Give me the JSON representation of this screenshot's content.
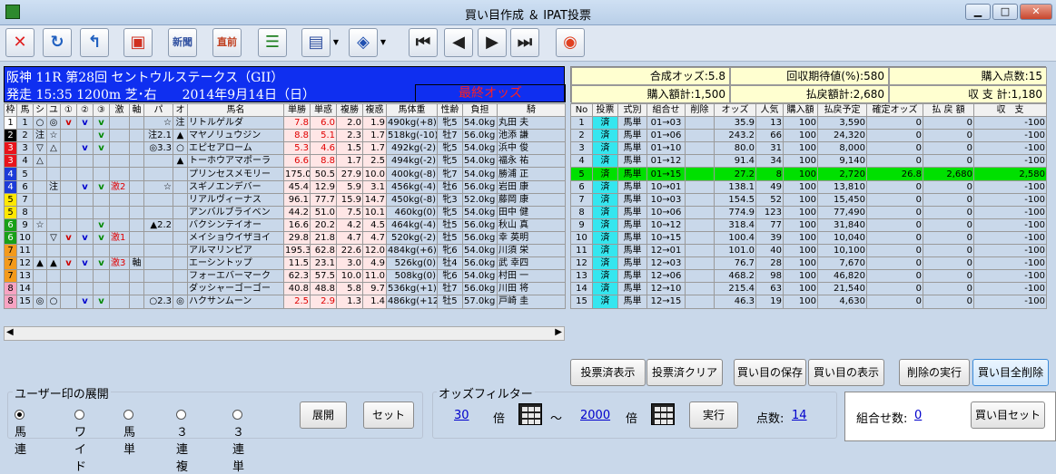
{
  "window": {
    "title": "買い目作成 ＆ IPAT投票"
  },
  "toolbar": {
    "buttons": [
      {
        "label": "✕",
        "name": "close-icon"
      },
      {
        "label": "↻",
        "name": "refresh-icon"
      },
      {
        "label": "↰",
        "name": "return-icon"
      },
      {
        "label": "▣",
        "name": "screen-icon"
      },
      {
        "label": "新聞",
        "name": "newspaper-icon"
      },
      {
        "label": "直前",
        "name": "latest-icon"
      },
      {
        "label": "☰",
        "name": "list-icon"
      },
      {
        "label": "▤",
        "name": "document-check-icon"
      },
      {
        "label": "◈",
        "name": "ipat-icon"
      },
      {
        "label": "⏮",
        "name": "first-icon"
      },
      {
        "label": "◀",
        "name": "prev-icon"
      },
      {
        "label": "▶",
        "name": "next-icon"
      },
      {
        "label": "⏭",
        "name": "last-icon"
      },
      {
        "label": "◉",
        "name": "exit-icon"
      }
    ]
  },
  "race": {
    "line1": "阪神 11R 第28回 セントウルステークス（GII）",
    "line2": "発走 15:35 1200m 芝･右　　2014年9月14日（日）",
    "status": "最終オッズ"
  },
  "summary": {
    "synth": "合成オッズ:5.8",
    "expect": "回収期待値(%):580",
    "points": "購入点数:15",
    "total": "購入額計:1,500",
    "refund": "払戻額計:2,680",
    "balance": "収 支 計:1,180"
  },
  "left_headers": [
    "枠",
    "馬",
    "シ",
    "ユ",
    "①",
    "②",
    "③",
    "激",
    "軸",
    "パ",
    "オ",
    "馬名",
    "単勝",
    "単惑",
    "複勝",
    "複惑",
    "馬体重",
    "性齢",
    "負担",
    "騎"
  ],
  "horses": [
    {
      "waku": "1",
      "no": "1",
      "s": "○",
      "u": "◎",
      "m1": "v",
      "m2": "v",
      "m3": "v",
      "geki": "",
      "jiku": "",
      "pa": "☆",
      "o": "注",
      "name": "リトルゲルダ",
      "win": "7.8",
      "wodd": "6.0",
      "place": "2.0",
      "podd": "1.9",
      "weight": "490kg(+8)",
      "sex": "牝5",
      "load": "54.0kg",
      "jockey": "丸田 夫"
    },
    {
      "waku": "2",
      "no": "2",
      "s": "注",
      "u": "☆",
      "m1": "",
      "m2": "",
      "m3": "v",
      "geki": "",
      "jiku": "",
      "pa": "注2.1",
      "o": "▲",
      "name": "マヤノリュウジン",
      "win": "8.8",
      "wodd": "5.1",
      "place": "2.3",
      "podd": "1.7",
      "weight": "518kg(-10)",
      "sex": "牡7",
      "load": "56.0kg",
      "jockey": "池添 謙"
    },
    {
      "waku": "3",
      "no": "3",
      "s": "▽",
      "u": "△",
      "m1": "",
      "m2": "v",
      "m3": "v",
      "geki": "",
      "jiku": "",
      "pa": "◎3.3",
      "o": "○",
      "name": "エピセアローム",
      "win": "5.3",
      "wodd": "4.6",
      "place": "1.5",
      "podd": "1.7",
      "weight": "492kg(-2)",
      "sex": "牝5",
      "load": "54.0kg",
      "jockey": "浜中 俊"
    },
    {
      "waku": "3",
      "no": "4",
      "s": "△",
      "u": "",
      "m1": "",
      "m2": "",
      "m3": "",
      "geki": "",
      "jiku": "",
      "pa": "",
      "o": "▲",
      "name": "トーホウアマポーラ",
      "win": "6.6",
      "wodd": "8.8",
      "place": "1.7",
      "podd": "2.5",
      "weight": "494kg(-2)",
      "sex": "牝5",
      "load": "54.0kg",
      "jockey": "福永 祐"
    },
    {
      "waku": "4",
      "no": "5",
      "s": "",
      "u": "",
      "m1": "",
      "m2": "",
      "m3": "",
      "geki": "",
      "jiku": "",
      "pa": "",
      "o": "",
      "name": "プリンセスメモリー",
      "win": "175.0",
      "wodd": "50.5",
      "place": "27.9",
      "podd": "10.0",
      "weight": "400kg(-8)",
      "sex": "牝7",
      "load": "54.0kg",
      "jockey": "勝浦 正"
    },
    {
      "waku": "4",
      "no": "6",
      "s": "",
      "u": "注",
      "m1": "",
      "m2": "v",
      "m3": "v",
      "geki": "激2",
      "jiku": "",
      "pa": "☆",
      "o": "",
      "name": "スギノエンデバー",
      "win": "45.4",
      "wodd": "12.9",
      "place": "5.9",
      "podd": "3.1",
      "weight": "456kg(-4)",
      "sex": "牡6",
      "load": "56.0kg",
      "jockey": "岩田 康"
    },
    {
      "waku": "5",
      "no": "7",
      "s": "",
      "u": "",
      "m1": "",
      "m2": "",
      "m3": "",
      "geki": "",
      "jiku": "",
      "pa": "",
      "o": "",
      "name": "リアルヴィーナス",
      "win": "96.1",
      "wodd": "77.7",
      "place": "15.9",
      "podd": "14.7",
      "weight": "450kg(-8)",
      "sex": "牝3",
      "load": "52.0kg",
      "jockey": "藤岡 康"
    },
    {
      "waku": "5",
      "no": "8",
      "s": "",
      "u": "",
      "m1": "",
      "m2": "",
      "m3": "",
      "geki": "",
      "jiku": "",
      "pa": "",
      "o": "",
      "name": "アンバルブライベン",
      "win": "44.2",
      "wodd": "51.0",
      "place": "7.5",
      "podd": "10.1",
      "weight": "460kg(0)",
      "sex": "牝5",
      "load": "54.0kg",
      "jockey": "田中 健"
    },
    {
      "waku": "6",
      "no": "9",
      "s": "☆",
      "u": "",
      "m1": "",
      "m2": "",
      "m3": "v",
      "geki": "",
      "jiku": "",
      "pa": "▲2.2",
      "o": "",
      "name": "バクシンテイオー",
      "win": "16.6",
      "wodd": "20.2",
      "place": "4.2",
      "podd": "4.5",
      "weight": "464kg(-4)",
      "sex": "牡5",
      "load": "56.0kg",
      "jockey": "秋山 真"
    },
    {
      "waku": "6",
      "no": "10",
      "s": "",
      "u": "▽",
      "m1": "v",
      "m2": "v",
      "m3": "v",
      "geki": "激1",
      "jiku": "",
      "pa": "",
      "o": "",
      "name": "メイショウイザヨイ",
      "win": "29.8",
      "wodd": "21.8",
      "place": "4.7",
      "podd": "4.7",
      "weight": "520kg(-2)",
      "sex": "牡5",
      "load": "56.0kg",
      "jockey": "幸 英明"
    },
    {
      "waku": "7",
      "no": "11",
      "s": "",
      "u": "",
      "m1": "",
      "m2": "",
      "m3": "",
      "geki": "",
      "jiku": "",
      "pa": "",
      "o": "",
      "name": "アルマリンピア",
      "win": "195.3",
      "wodd": "62.8",
      "place": "22.6",
      "podd": "12.0",
      "weight": "484kg(+6)",
      "sex": "牝6",
      "load": "54.0kg",
      "jockey": "川須 栄"
    },
    {
      "waku": "7",
      "no": "12",
      "s": "▲",
      "u": "▲",
      "m1": "v",
      "m2": "v",
      "m3": "v",
      "geki": "激3",
      "jiku": "軸",
      "pa": "",
      "o": "",
      "name": "エーシントップ",
      "win": "11.5",
      "wodd": "23.1",
      "place": "3.0",
      "podd": "4.9",
      "weight": "526kg(0)",
      "sex": "牡4",
      "load": "56.0kg",
      "jockey": "武 幸四"
    },
    {
      "waku": "7",
      "no": "13",
      "s": "",
      "u": "",
      "m1": "",
      "m2": "",
      "m3": "",
      "geki": "",
      "jiku": "",
      "pa": "",
      "o": "",
      "name": "フォーエバーマーク",
      "win": "62.3",
      "wodd": "57.5",
      "place": "10.0",
      "podd": "11.0",
      "weight": "508kg(0)",
      "sex": "牝6",
      "load": "54.0kg",
      "jockey": "村田 一"
    },
    {
      "waku": "8",
      "no": "14",
      "s": "",
      "u": "",
      "m1": "",
      "m2": "",
      "m3": "",
      "geki": "",
      "jiku": "",
      "pa": "",
      "o": "",
      "name": "ダッシャーゴーゴー",
      "win": "40.8",
      "wodd": "48.8",
      "place": "5.8",
      "podd": "9.7",
      "weight": "536kg(+1)",
      "sex": "牡7",
      "load": "56.0kg",
      "jockey": "川田 将"
    },
    {
      "waku": "8",
      "no": "15",
      "s": "◎",
      "u": "○",
      "m1": "",
      "m2": "v",
      "m3": "v",
      "geki": "",
      "jiku": "",
      "pa": "○2.3",
      "o": "◎",
      "name": "ハクサンムーン",
      "win": "2.5",
      "wodd": "2.9",
      "place": "1.3",
      "podd": "1.4",
      "weight": "486kg(+12)",
      "sex": "牡5",
      "load": "57.0kg",
      "jockey": "戸崎 圭"
    }
  ],
  "right_headers": [
    "No",
    "投票",
    "式別",
    "組合せ",
    "削除",
    "オッズ",
    "人気",
    "購入額",
    "払戻予定",
    "確定オッズ",
    "払 戻 額",
    "収　支"
  ],
  "bets": [
    {
      "no": "1",
      "vote": "済",
      "type": "馬単",
      "combo": "01→03",
      "del": "",
      "odds": "35.9",
      "pop": "13",
      "amt": "100",
      "ref": "3,590",
      "fodds": "0",
      "pay": "0",
      "bal": "-100"
    },
    {
      "no": "2",
      "vote": "済",
      "type": "馬単",
      "combo": "01→06",
      "del": "",
      "odds": "243.2",
      "pop": "66",
      "amt": "100",
      "ref": "24,320",
      "fodds": "0",
      "pay": "0",
      "bal": "-100"
    },
    {
      "no": "3",
      "vote": "済",
      "type": "馬単",
      "combo": "01→10",
      "del": "",
      "odds": "80.0",
      "pop": "31",
      "amt": "100",
      "ref": "8,000",
      "fodds": "0",
      "pay": "0",
      "bal": "-100"
    },
    {
      "no": "4",
      "vote": "済",
      "type": "馬単",
      "combo": "01→12",
      "del": "",
      "odds": "91.4",
      "pop": "34",
      "amt": "100",
      "ref": "9,140",
      "fodds": "0",
      "pay": "0",
      "bal": "-100"
    },
    {
      "no": "5",
      "vote": "済",
      "type": "馬単",
      "combo": "01→15",
      "del": "",
      "odds": "27.2",
      "pop": "8",
      "amt": "100",
      "ref": "2,720",
      "fodds": "26.8",
      "pay": "2,680",
      "bal": "2,580",
      "hit": true
    },
    {
      "no": "6",
      "vote": "済",
      "type": "馬単",
      "combo": "10→01",
      "del": "",
      "odds": "138.1",
      "pop": "49",
      "amt": "100",
      "ref": "13,810",
      "fodds": "0",
      "pay": "0",
      "bal": "-100"
    },
    {
      "no": "7",
      "vote": "済",
      "type": "馬単",
      "combo": "10→03",
      "del": "",
      "odds": "154.5",
      "pop": "52",
      "amt": "100",
      "ref": "15,450",
      "fodds": "0",
      "pay": "0",
      "bal": "-100"
    },
    {
      "no": "8",
      "vote": "済",
      "type": "馬単",
      "combo": "10→06",
      "del": "",
      "odds": "774.9",
      "pop": "123",
      "amt": "100",
      "ref": "77,490",
      "fodds": "0",
      "pay": "0",
      "bal": "-100"
    },
    {
      "no": "9",
      "vote": "済",
      "type": "馬単",
      "combo": "10→12",
      "del": "",
      "odds": "318.4",
      "pop": "77",
      "amt": "100",
      "ref": "31,840",
      "fodds": "0",
      "pay": "0",
      "bal": "-100"
    },
    {
      "no": "10",
      "vote": "済",
      "type": "馬単",
      "combo": "10→15",
      "del": "",
      "odds": "100.4",
      "pop": "39",
      "amt": "100",
      "ref": "10,040",
      "fodds": "0",
      "pay": "0",
      "bal": "-100"
    },
    {
      "no": "11",
      "vote": "済",
      "type": "馬単",
      "combo": "12→01",
      "del": "",
      "odds": "101.0",
      "pop": "40",
      "amt": "100",
      "ref": "10,100",
      "fodds": "0",
      "pay": "0",
      "bal": "-100"
    },
    {
      "no": "12",
      "vote": "済",
      "type": "馬単",
      "combo": "12→03",
      "del": "",
      "odds": "76.7",
      "pop": "28",
      "amt": "100",
      "ref": "7,670",
      "fodds": "0",
      "pay": "0",
      "bal": "-100"
    },
    {
      "no": "13",
      "vote": "済",
      "type": "馬単",
      "combo": "12→06",
      "del": "",
      "odds": "468.2",
      "pop": "98",
      "amt": "100",
      "ref": "46,820",
      "fodds": "0",
      "pay": "0",
      "bal": "-100"
    },
    {
      "no": "14",
      "vote": "済",
      "type": "馬単",
      "combo": "12→10",
      "del": "",
      "odds": "215.4",
      "pop": "63",
      "amt": "100",
      "ref": "21,540",
      "fodds": "0",
      "pay": "0",
      "bal": "-100"
    },
    {
      "no": "15",
      "vote": "済",
      "type": "馬単",
      "combo": "12→15",
      "del": "",
      "odds": "46.3",
      "pop": "19",
      "amt": "100",
      "ref": "4,630",
      "fodds": "0",
      "pay": "0",
      "bal": "-100"
    }
  ],
  "actions": [
    "投票済表示",
    "投票済クリア",
    "買い目の保存",
    "買い目の表示",
    "削除の実行",
    "買い目全削除"
  ],
  "user_group": {
    "label": "ユーザー印の展開",
    "options": [
      "馬連",
      "ワイド",
      "馬単",
      "３連複",
      "３連単"
    ],
    "selected": 0,
    "expand": "展開",
    "set": "セット"
  },
  "odds_filter": {
    "label": "オッズフィルター",
    "min": "30",
    "unit": "倍",
    "tilde": "～",
    "max": "2000",
    "run": "実行",
    "count_label": "点数:",
    "count": "14"
  },
  "combo": {
    "label": "組合せ数:",
    "count": "0",
    "set": "買い目セット"
  },
  "colors": {
    "waku": {
      "1": "#ffffff",
      "2": "#000000",
      "3": "#e8141c",
      "4": "#1c3bd8",
      "5": "#ffe800",
      "6": "#18a018",
      "7": "#f39a1c",
      "8": "#f7a3c2"
    }
  }
}
